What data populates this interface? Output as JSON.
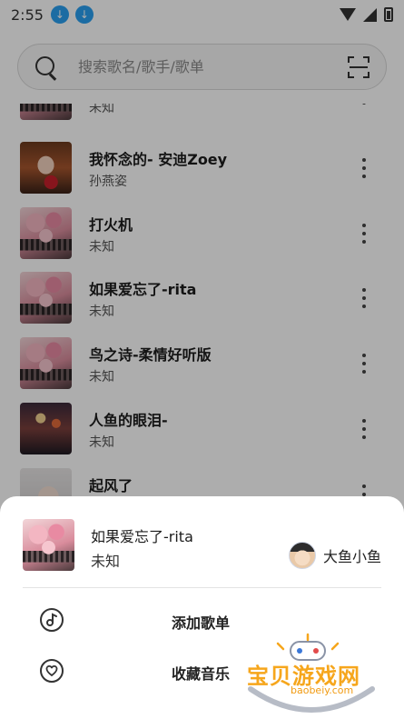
{
  "status_bar": {
    "time": "2:55",
    "download_badges": [
      "download-icon",
      "download-icon"
    ],
    "icons": [
      "wifi-icon",
      "signal-icon",
      "battery-icon"
    ]
  },
  "search": {
    "placeholder": "搜索歌名/歌手/歌单",
    "value": ""
  },
  "songs": [
    {
      "title": "",
      "artist": "未知",
      "cover": "roses"
    },
    {
      "title": "我怀念的- 安迪Zoey",
      "artist": "孙燕姿",
      "cover": "portrait"
    },
    {
      "title": "打火机",
      "artist": "未知",
      "cover": "roses"
    },
    {
      "title": "如果爱忘了-rita",
      "artist": "未知",
      "cover": "roses"
    },
    {
      "title": "鸟之诗-柔情好听版",
      "artist": "未知",
      "cover": "roses"
    },
    {
      "title": "人鱼的眼泪-",
      "artist": "未知",
      "cover": "concert"
    },
    {
      "title": "起风了",
      "artist": "",
      "cover": "face"
    }
  ],
  "sheet": {
    "song_title": "如果爱忘了-rita",
    "song_artist": "未知",
    "owner_name": "大鱼小鱼",
    "actions": [
      {
        "label": "添加歌单",
        "icon": "music-note-icon"
      },
      {
        "label": "收藏音乐",
        "icon": "heart-icon"
      }
    ]
  },
  "watermark": {
    "text": "宝贝游戏网",
    "url": "baobeiy.com"
  },
  "colors": {
    "accent_download": "#2aa0f0",
    "watermark": "#f6a61c"
  }
}
